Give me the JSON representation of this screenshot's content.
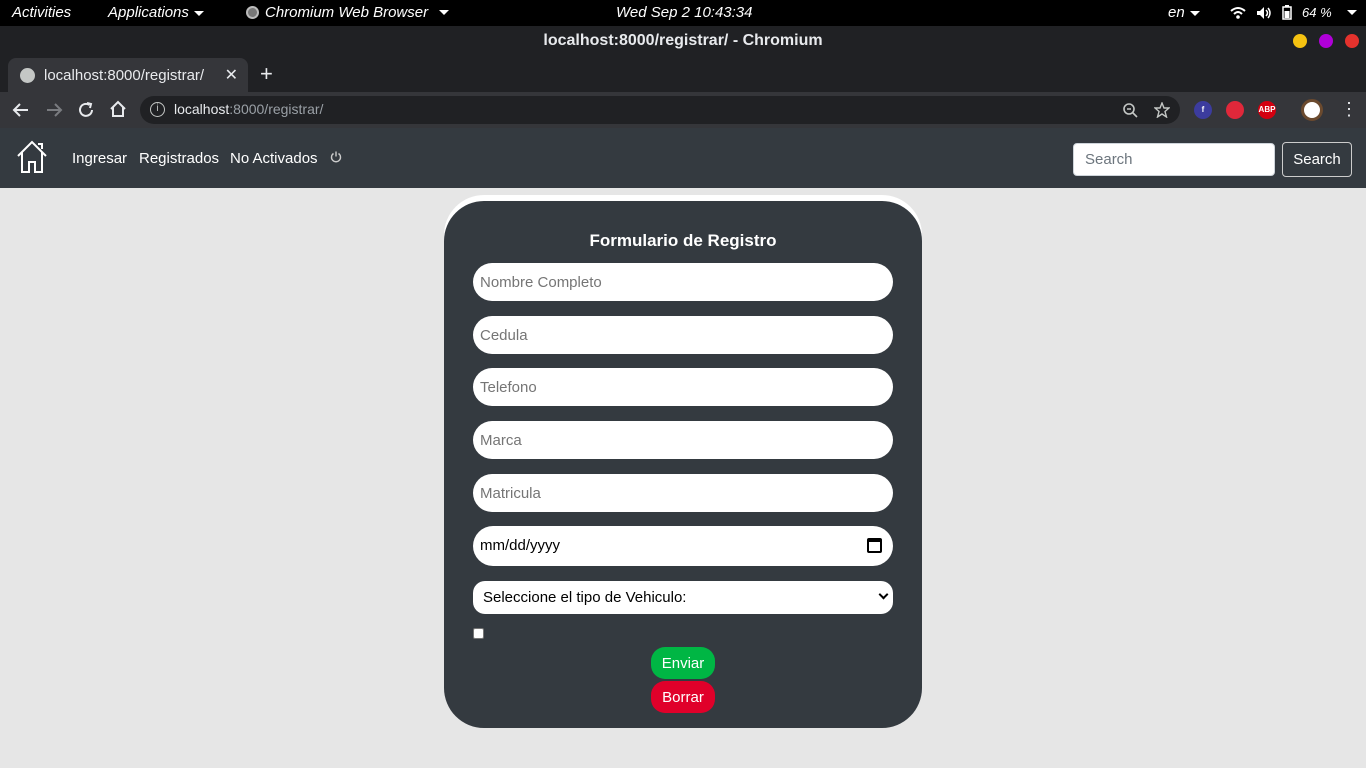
{
  "system_bar": {
    "activities": "Activities",
    "applications": "Applications",
    "app_name": "Chromium Web Browser",
    "clock": "Wed Sep 2  10:43:34",
    "language": "en",
    "battery": "64 %"
  },
  "window": {
    "title": "localhost:8000/registrar/ - Chromium"
  },
  "tabs": [
    {
      "label": "localhost:8000/registrar/"
    }
  ],
  "omnibox": {
    "host": "localhost",
    "path": ":8000/registrar/"
  },
  "extensions": [
    {
      "label": "f",
      "color": "#3c3c9e"
    },
    {
      "label": "",
      "color": "#e0283a"
    },
    {
      "label": "ABP",
      "color": "#d30010"
    }
  ],
  "navbar": {
    "links": [
      "Ingresar",
      "Registrados",
      "No Activados"
    ],
    "search_placeholder": "Search",
    "search_button": "Search"
  },
  "form": {
    "title": "Formulario de Registro",
    "fields": [
      {
        "placeholder": "Nombre Completo"
      },
      {
        "placeholder": "Cedula"
      },
      {
        "placeholder": "Telefono"
      },
      {
        "placeholder": "Marca"
      },
      {
        "placeholder": "Matricula"
      }
    ],
    "date_placeholder": "mm/dd/yyyy",
    "vehicle_select": "Seleccione el tipo de Vehiculo:",
    "submit_label": "Enviar",
    "reset_label": "Borrar"
  },
  "colors": {
    "navbar": "#343a40",
    "card": "#343a40",
    "submit": "#00b644",
    "reset": "#e0002a",
    "page_bg": "#e6e6e6"
  }
}
